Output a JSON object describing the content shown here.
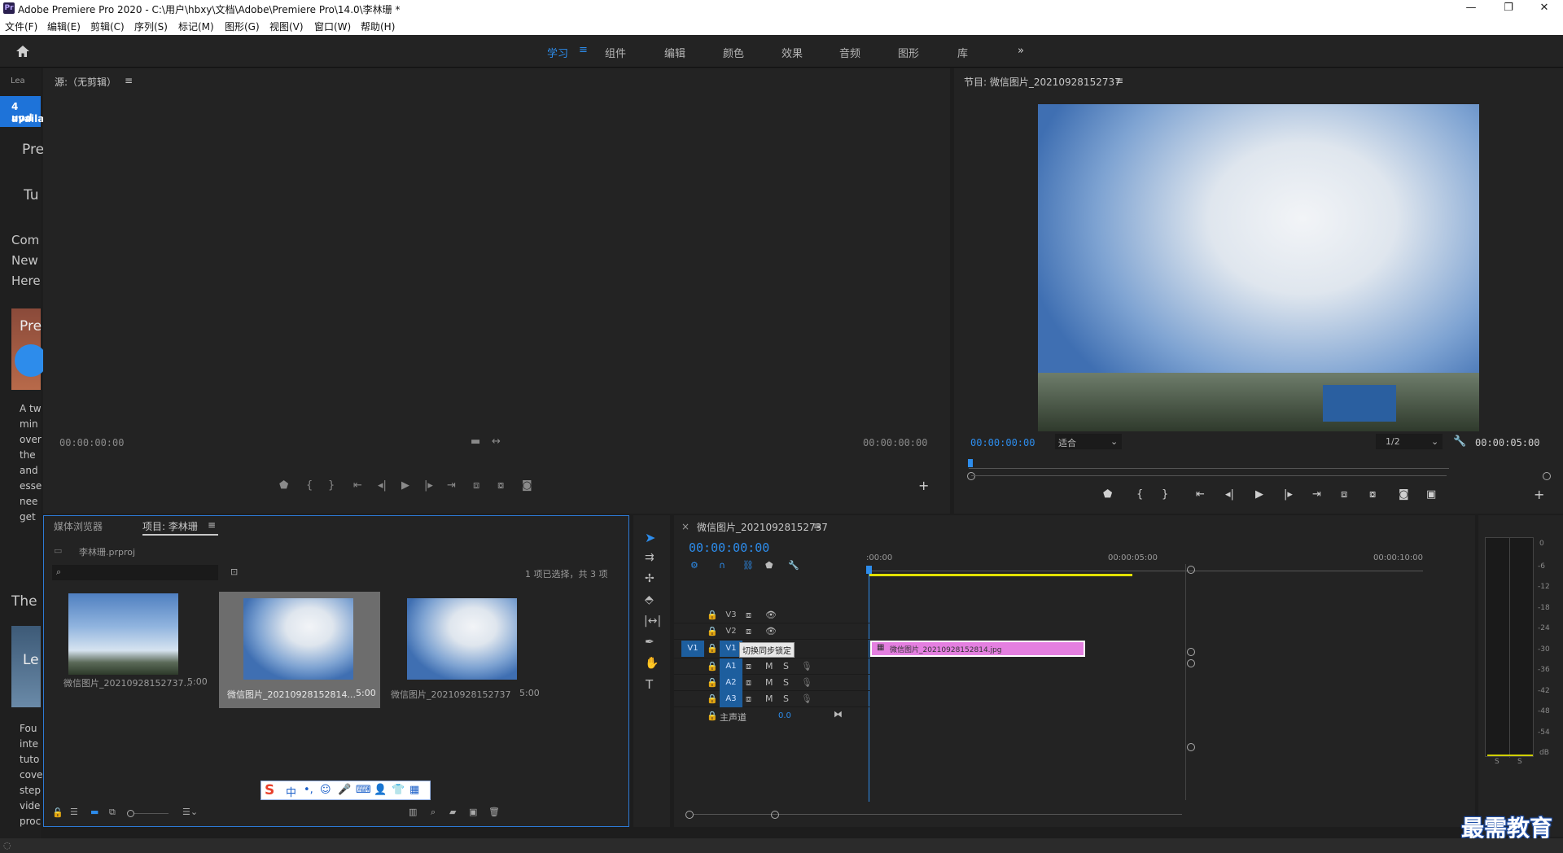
{
  "app": {
    "title": "Adobe Premiere Pro 2020 - C:\\用户\\hbxy\\文档\\Adobe\\Premiere Pro\\14.0\\李林珊 *",
    "logo_text": "Pr"
  },
  "window_controls": {
    "minimize": "—",
    "maximize": "❐",
    "close": "✕"
  },
  "menu": [
    "文件(F)",
    "编辑(E)",
    "剪辑(C)",
    "序列(S)",
    "标记(M)",
    "图形(G)",
    "视图(V)",
    "窗口(W)",
    "帮助(H)"
  ],
  "workspaces": {
    "items": [
      "学习",
      "组件",
      "编辑",
      "颜色",
      "效果",
      "音频",
      "图形",
      "库"
    ],
    "active": "学习",
    "active_menu_icon": "≡",
    "more": "»"
  },
  "learn_panel": {
    "tab": "Lea",
    "banner_line1": "4 upd",
    "banner_line2": "availa",
    "items": [
      "Pre",
      "Tu",
      "Com",
      "New",
      "Here",
      "Pre",
      "A tw",
      "min",
      "over",
      "the",
      "and",
      "esse",
      "nee",
      "get",
      "The",
      "Le",
      "Fou",
      "inte",
      "tuto",
      "cove",
      "step",
      "vide",
      "proc"
    ]
  },
  "source_monitor": {
    "title": "源:（无剪辑）",
    "menu_icon": "≡",
    "timecode_left": "00:00:00:00",
    "timecode_right": "00:00:00:00"
  },
  "program_monitor": {
    "title": "节目: 微信图片_20210928152737",
    "menu_icon": "≡",
    "timecode_current": "00:00:00:00",
    "zoom": "适合",
    "resolution": "1/2",
    "timecode_duration": "00:00:05:00"
  },
  "project_panel": {
    "tabs": [
      "媒体浏览器",
      "项目: 李林珊"
    ],
    "active_tab": "项目: 李林珊",
    "menu_icon": "≡",
    "project_file": "李林珊.prproj",
    "selection_status": "1 项已选择，共 3 项",
    "items": [
      {
        "name": "微信图片_20210928152737...",
        "duration": "5:00",
        "selected": false
      },
      {
        "name": "微信图片_20210928152814...",
        "duration": "5:00",
        "selected": true
      },
      {
        "name": "微信图片_20210928152737",
        "duration": "5:00",
        "selected": false
      }
    ]
  },
  "timeline": {
    "close_icon": "×",
    "title": "微信图片_20210928152737",
    "menu_icon": "≡",
    "timecode": "00:00:00:00",
    "ruler": [
      ":00:00",
      "00:00:05:00",
      "00:00:10:00"
    ],
    "video_tracks": [
      {
        "name": "V3",
        "source": ""
      },
      {
        "name": "V2",
        "source": ""
      },
      {
        "name": "V1",
        "source": "V1"
      }
    ],
    "audio_tracks": [
      {
        "name": "A1"
      },
      {
        "name": "A2"
      },
      {
        "name": "A3"
      }
    ],
    "mix_label": "主声道",
    "mix_value": "0.0",
    "tooltip": "切换同步锁定",
    "clip_name": "微信图片_20210928152814.jpg",
    "track_buttons": {
      "mute": "M",
      "solo": "S"
    }
  },
  "audio_meter": {
    "scale": [
      "0",
      "-6",
      "-12",
      "-18",
      "-24",
      "-30",
      "-36",
      "-42",
      "-48",
      "-54",
      "dB"
    ],
    "channels": [
      "S",
      "S"
    ]
  },
  "ime_toolbar": {
    "items": [
      "中",
      "•,",
      "☺",
      "🎤",
      "⌨",
      "👤",
      "👕",
      "▦"
    ]
  },
  "watermark": "最需教育",
  "colors": {
    "accent": "#2d8ceb",
    "clip": "#e47fe0",
    "work_area": "#e2e000",
    "playhead": "#2d8ceb"
  }
}
